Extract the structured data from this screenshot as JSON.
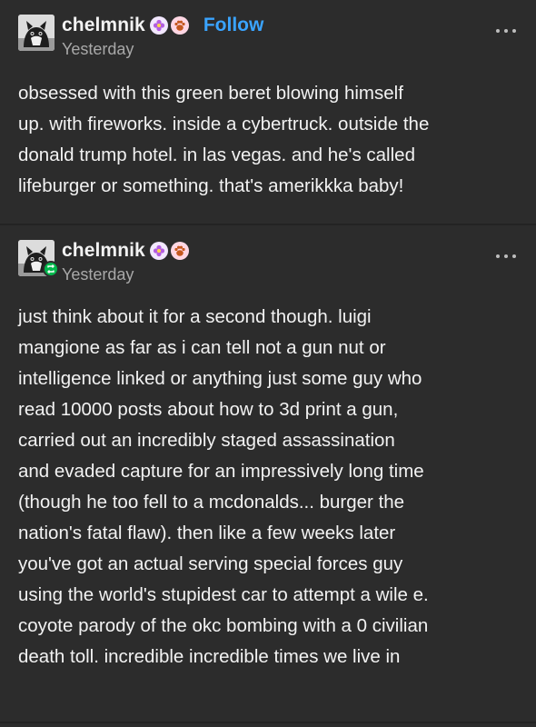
{
  "posts": [
    {
      "username": "chelmnik",
      "follow_label": "Follow",
      "timestamp": "Yesterday",
      "avatar_icon": "cat-avatar",
      "badges": [
        "flower-badge",
        "paw-badge"
      ],
      "lines": [
        "obsessed with this green beret blowing himself",
        "up. with fireworks. inside a cybertruck. outside the",
        "donald trump hotel. in las vegas. and he's called",
        "lifeburger or something. that's amerikkka baby!"
      ]
    },
    {
      "username": "chelmnik",
      "timestamp": "Yesterday",
      "avatar_icon": "cat-avatar",
      "reblog_icon": "reblog-icon",
      "badges": [
        "flower-badge",
        "paw-badge"
      ],
      "lines": [
        "just think about it for a second though. luigi",
        "mangione as far as i can tell not a gun nut or",
        "intelligence linked or anything just some guy who",
        "read 10000 posts about how to 3d print a gun,",
        "carried out an incredibly staged assassination",
        "and evaded capture for an impressively long time",
        "(though he too fell to a mcdonalds... burger the",
        "nation's fatal flaw). then like a few weeks later",
        "you've got an actual serving special forces guy",
        "using the world's stupidest car to attempt a wile e.",
        "coyote parody of the okc bombing with a 0 civilian",
        "death toll. incredible incredible times we live in"
      ]
    }
  ],
  "colors": {
    "background": "#2c2c2c",
    "text": "#f2f2f2",
    "muted": "#a8a8a8",
    "follow": "#3aa4ff",
    "reblog": "#00b84c"
  }
}
